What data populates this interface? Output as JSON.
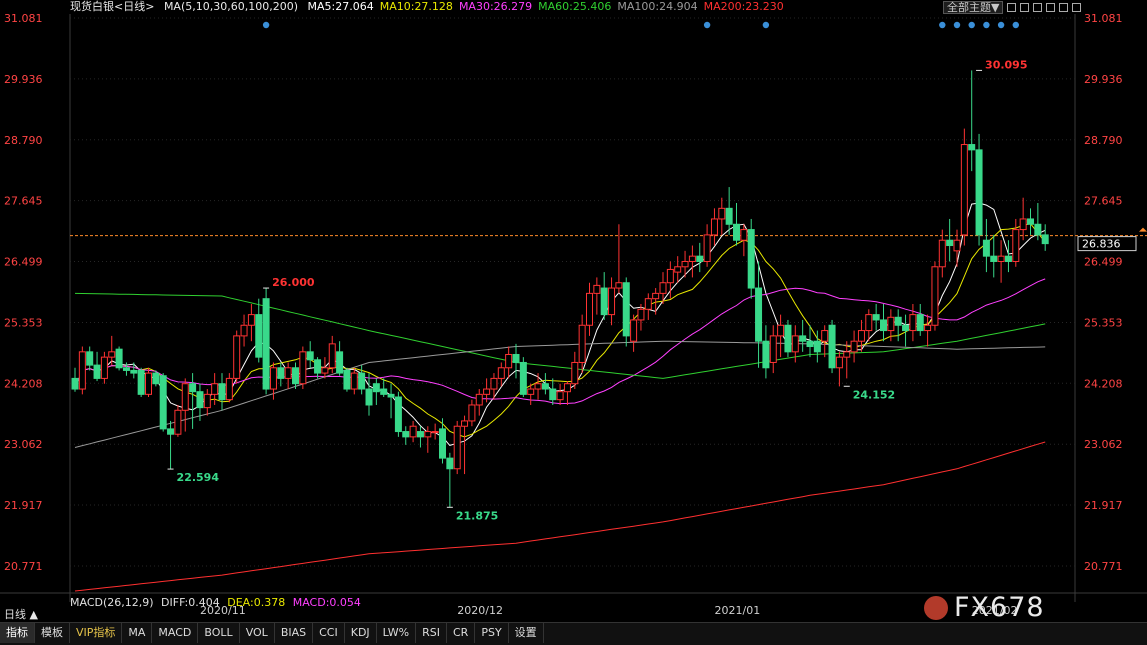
{
  "header": {
    "instrument": "现货白银",
    "period_tag": "<日线>",
    "ma_params": "MA(5,10,30,60,100,200)",
    "ma_values": [
      {
        "label": "MA5:27.064",
        "color": "#ffffff"
      },
      {
        "label": "MA10:27.128",
        "color": "#e8e800"
      },
      {
        "label": "MA30:26.279",
        "color": "#ff40ff"
      },
      {
        "label": "MA60:25.406",
        "color": "#30d030"
      },
      {
        "label": "MA100:24.904",
        "color": "#9a9a9a"
      },
      {
        "label": "MA200:23.230",
        "color": "#ff3030"
      }
    ],
    "theme_button": "全部主题▼"
  },
  "colors": {
    "up": "#ff3333",
    "down": "#39d98a",
    "axis_text": "#ff4444",
    "grid": "#262626",
    "price_line": "#ff8a2a"
  },
  "chart_data": {
    "type": "candlestick",
    "y_ticks": [
      "31.081",
      "29.936",
      "28.790",
      "27.645",
      "26.499",
      "25.353",
      "24.208",
      "23.062",
      "21.917",
      "20.771"
    ],
    "ylim": [
      20.3,
      31.081
    ],
    "current_price": "26.836",
    "x_labels": [
      "2020/11",
      "2020/12",
      "2021/01",
      "2021/02"
    ],
    "annotations": [
      {
        "label": "26.000",
        "type": "high",
        "index": 26,
        "value": 26.0
      },
      {
        "label": "22.594",
        "type": "low",
        "index": 13,
        "value": 22.594
      },
      {
        "label": "21.875",
        "type": "low",
        "index": 51,
        "value": 21.875
      },
      {
        "label": "24.152",
        "type": "low",
        "index": 105,
        "value": 24.152
      },
      {
        "label": "30.095",
        "type": "high",
        "index": 123,
        "value": 30.095
      }
    ],
    "event_dots": [
      26,
      86,
      94,
      118,
      120,
      122,
      124,
      126,
      128
    ],
    "ohlc": [
      [
        24.3,
        24.5,
        24.05,
        24.1
      ],
      [
        24.1,
        24.9,
        24.0,
        24.8
      ],
      [
        24.8,
        24.9,
        24.45,
        24.55
      ],
      [
        24.55,
        24.8,
        24.25,
        24.3
      ],
      [
        24.3,
        24.8,
        24.2,
        24.7
      ],
      [
        24.7,
        25.1,
        24.55,
        24.8
      ],
      [
        24.85,
        24.9,
        24.45,
        24.5
      ],
      [
        24.5,
        24.6,
        24.35,
        24.45
      ],
      [
        24.45,
        24.6,
        24.3,
        24.4
      ],
      [
        24.45,
        24.5,
        23.95,
        24.0
      ],
      [
        24.0,
        24.5,
        23.95,
        24.4
      ],
      [
        24.4,
        24.45,
        24.15,
        24.2
      ],
      [
        24.35,
        24.4,
        23.3,
        23.35
      ],
      [
        23.35,
        23.5,
        22.6,
        23.25
      ],
      [
        23.25,
        23.8,
        23.2,
        23.7
      ],
      [
        23.7,
        24.3,
        23.3,
        24.2
      ],
      [
        24.2,
        24.4,
        23.35,
        24.05
      ],
      [
        24.05,
        24.2,
        23.5,
        23.75
      ],
      [
        23.75,
        24.1,
        23.6,
        24.0
      ],
      [
        24.0,
        24.4,
        23.8,
        24.2
      ],
      [
        24.2,
        24.4,
        23.7,
        23.9
      ],
      [
        23.9,
        24.4,
        23.85,
        24.3
      ],
      [
        24.3,
        25.2,
        24.2,
        25.1
      ],
      [
        25.1,
        25.5,
        24.9,
        25.3
      ],
      [
        25.3,
        25.7,
        25.0,
        25.5
      ],
      [
        25.5,
        25.8,
        24.6,
        24.7
      ],
      [
        25.8,
        26.0,
        24.0,
        24.1
      ],
      [
        24.1,
        24.6,
        23.9,
        24.5
      ],
      [
        24.5,
        24.6,
        24.15,
        24.3
      ],
      [
        24.3,
        24.6,
        24.1,
        24.5
      ],
      [
        24.5,
        24.6,
        24.1,
        24.2
      ],
      [
        24.2,
        24.9,
        24.1,
        24.8
      ],
      [
        24.8,
        25.0,
        24.5,
        24.65
      ],
      [
        24.65,
        24.7,
        24.3,
        24.4
      ],
      [
        24.4,
        24.7,
        24.3,
        24.5
      ],
      [
        24.5,
        25.1,
        24.4,
        24.95
      ],
      [
        24.8,
        25.0,
        24.35,
        24.4
      ],
      [
        24.45,
        24.5,
        24.05,
        24.1
      ],
      [
        24.1,
        24.5,
        24.0,
        24.4
      ],
      [
        24.4,
        24.55,
        24.0,
        24.1
      ],
      [
        24.1,
        24.4,
        23.6,
        23.8
      ],
      [
        24.2,
        24.3,
        23.8,
        24.05
      ],
      [
        24.1,
        24.3,
        23.95,
        24.0
      ],
      [
        24.0,
        24.2,
        23.55,
        23.95
      ],
      [
        23.95,
        24.05,
        23.2,
        23.3
      ],
      [
        23.3,
        23.4,
        23.05,
        23.2
      ],
      [
        23.2,
        23.5,
        23.1,
        23.4
      ],
      [
        23.3,
        23.4,
        23.0,
        23.2
      ],
      [
        23.2,
        23.4,
        22.9,
        23.3
      ],
      [
        23.3,
        23.45,
        23.15,
        23.3
      ],
      [
        23.35,
        23.55,
        22.7,
        22.8
      ],
      [
        22.8,
        22.9,
        21.875,
        22.6
      ],
      [
        22.6,
        23.5,
        22.5,
        23.4
      ],
      [
        23.4,
        23.6,
        22.5,
        23.5
      ],
      [
        23.5,
        23.9,
        23.4,
        23.8
      ],
      [
        23.8,
        24.1,
        23.6,
        24.0
      ],
      [
        24.0,
        24.3,
        23.85,
        24.1
      ],
      [
        24.1,
        24.4,
        23.9,
        24.3
      ],
      [
        24.3,
        24.6,
        24.15,
        24.5
      ],
      [
        24.5,
        24.9,
        24.3,
        24.75
      ],
      [
        24.75,
        24.95,
        24.3,
        24.6
      ],
      [
        24.6,
        24.7,
        23.95,
        24.0
      ],
      [
        24.0,
        24.2,
        23.8,
        24.1
      ],
      [
        24.1,
        24.4,
        23.9,
        24.2
      ],
      [
        24.2,
        24.4,
        24.0,
        24.1
      ],
      [
        24.1,
        24.3,
        23.8,
        23.9
      ],
      [
        23.9,
        24.2,
        23.8,
        24.05
      ],
      [
        24.05,
        24.25,
        23.8,
        24.2
      ],
      [
        24.2,
        24.8,
        24.1,
        24.6
      ],
      [
        24.6,
        25.5,
        24.4,
        25.3
      ],
      [
        25.3,
        26.1,
        25.1,
        25.9
      ],
      [
        25.9,
        26.2,
        25.5,
        26.05
      ],
      [
        26.0,
        26.3,
        25.4,
        25.5
      ],
      [
        25.5,
        26.2,
        25.3,
        26.0
      ],
      [
        26.0,
        27.2,
        25.9,
        26.1
      ],
      [
        26.1,
        26.2,
        24.9,
        25.1
      ],
      [
        25.0,
        25.5,
        24.8,
        25.4
      ],
      [
        25.4,
        25.7,
        25.2,
        25.6
      ],
      [
        25.6,
        25.9,
        25.4,
        25.8
      ],
      [
        25.8,
        26.0,
        25.5,
        25.9
      ],
      [
        25.9,
        26.3,
        25.7,
        26.1
      ],
      [
        26.1,
        26.5,
        25.8,
        26.35
      ],
      [
        26.3,
        26.6,
        26.1,
        26.4
      ],
      [
        26.4,
        26.7,
        26.2,
        26.5
      ],
      [
        26.5,
        26.8,
        26.2,
        26.6
      ],
      [
        26.6,
        26.85,
        26.3,
        26.5
      ],
      [
        26.5,
        27.2,
        26.4,
        27.0
      ],
      [
        27.0,
        27.5,
        26.8,
        27.3
      ],
      [
        27.3,
        27.7,
        27.0,
        27.5
      ],
      [
        27.5,
        27.9,
        27.0,
        27.2
      ],
      [
        27.2,
        27.6,
        26.8,
        26.9
      ],
      [
        26.9,
        27.2,
        26.6,
        27.1
      ],
      [
        27.1,
        27.3,
        25.8,
        26.0
      ],
      [
        26.0,
        26.5,
        24.5,
        25.0
      ],
      [
        25.0,
        25.3,
        24.3,
        24.5
      ],
      [
        24.6,
        25.3,
        24.4,
        25.1
      ],
      [
        25.1,
        25.5,
        24.7,
        25.3
      ],
      [
        25.3,
        25.4,
        24.7,
        24.8
      ],
      [
        24.8,
        25.3,
        24.6,
        25.1
      ],
      [
        25.1,
        25.4,
        24.8,
        25.0
      ],
      [
        25.0,
        25.3,
        24.7,
        24.9
      ],
      [
        25.0,
        25.2,
        24.6,
        24.8
      ],
      [
        25.0,
        25.3,
        24.7,
        25.2
      ],
      [
        25.3,
        25.4,
        24.4,
        24.5
      ],
      [
        24.5,
        24.8,
        24.15,
        24.7
      ],
      [
        24.7,
        25.0,
        24.3,
        24.8
      ],
      [
        24.8,
        25.2,
        24.6,
        25.0
      ],
      [
        25.0,
        25.4,
        24.8,
        25.2
      ],
      [
        25.2,
        25.6,
        25.0,
        25.5
      ],
      [
        25.5,
        25.7,
        25.2,
        25.4
      ],
      [
        25.4,
        25.7,
        25.0,
        25.2
      ],
      [
        25.2,
        25.6,
        25.0,
        25.45
      ],
      [
        25.45,
        25.6,
        25.0,
        25.3
      ],
      [
        25.3,
        25.5,
        24.9,
        25.2
      ],
      [
        25.2,
        25.7,
        25.0,
        25.5
      ],
      [
        25.5,
        25.7,
        25.1,
        25.2
      ],
      [
        25.2,
        25.5,
        24.9,
        25.3
      ],
      [
        25.3,
        26.5,
        25.2,
        26.4
      ],
      [
        26.4,
        27.1,
        26.2,
        26.9
      ],
      [
        26.9,
        27.3,
        26.5,
        26.8
      ],
      [
        26.7,
        27.1,
        26.4,
        26.9
      ],
      [
        27.0,
        29.0,
        26.8,
        28.7
      ],
      [
        28.7,
        30.095,
        28.2,
        28.6
      ],
      [
        28.6,
        28.9,
        26.8,
        27.0
      ],
      [
        26.9,
        27.3,
        26.3,
        26.6
      ],
      [
        26.6,
        27.0,
        26.2,
        26.5
      ],
      [
        26.5,
        26.9,
        26.1,
        26.6
      ],
      [
        26.6,
        26.9,
        26.3,
        26.5
      ],
      [
        26.5,
        27.3,
        26.4,
        27.1
      ],
      [
        27.1,
        27.7,
        26.9,
        27.3
      ],
      [
        27.3,
        27.5,
        27.0,
        27.2
      ],
      [
        27.2,
        27.6,
        26.9,
        27.0
      ],
      [
        27.0,
        27.2,
        26.7,
        26.836
      ]
    ],
    "ma_lines": [
      {
        "name": "MA5",
        "color": "#ffffff"
      },
      {
        "name": "MA10",
        "color": "#e8e800"
      },
      {
        "name": "MA30",
        "color": "#ff40ff"
      },
      {
        "name": "MA60",
        "color": "#30d030"
      },
      {
        "name": "MA100",
        "color": "#9a9a9a"
      },
      {
        "name": "MA200",
        "color": "#ff3030"
      }
    ],
    "ma_tracks": {
      "MA60": [
        [
          0,
          25.9
        ],
        [
          20,
          25.85
        ],
        [
          40,
          25.2
        ],
        [
          60,
          24.6
        ],
        [
          80,
          24.3
        ],
        [
          100,
          24.75
        ],
        [
          110,
          24.8
        ],
        [
          120,
          25.0
        ],
        [
          135,
          25.406
        ]
      ],
      "MA100": [
        [
          0,
          23.0
        ],
        [
          20,
          23.7
        ],
        [
          40,
          24.6
        ],
        [
          60,
          24.9
        ],
        [
          80,
          25.0
        ],
        [
          100,
          24.95
        ],
        [
          110,
          24.9
        ],
        [
          120,
          24.85
        ],
        [
          135,
          24.904
        ]
      ],
      "MA200": [
        [
          0,
          20.3
        ],
        [
          20,
          20.6
        ],
        [
          40,
          21.0
        ],
        [
          60,
          21.2
        ],
        [
          80,
          21.6
        ],
        [
          100,
          22.1
        ],
        [
          110,
          22.3
        ],
        [
          120,
          22.6
        ],
        [
          135,
          23.23
        ]
      ]
    }
  },
  "macd": {
    "label": "MACD(26,12,9)",
    "diff": "DIFF:0.404",
    "dea": "DEA:0.378",
    "macd": "MACD:0.054"
  },
  "period_label": "日线",
  "period_arrow": "▲",
  "bottom_tabs": [
    "指标",
    "模板",
    "VIP指标",
    "MA",
    "MACD",
    "BOLL",
    "VOL",
    "BIAS",
    "CCI",
    "KDJ",
    "LW%",
    "RSI",
    "CR",
    "PSY",
    "设置"
  ],
  "watermark": "FX678"
}
